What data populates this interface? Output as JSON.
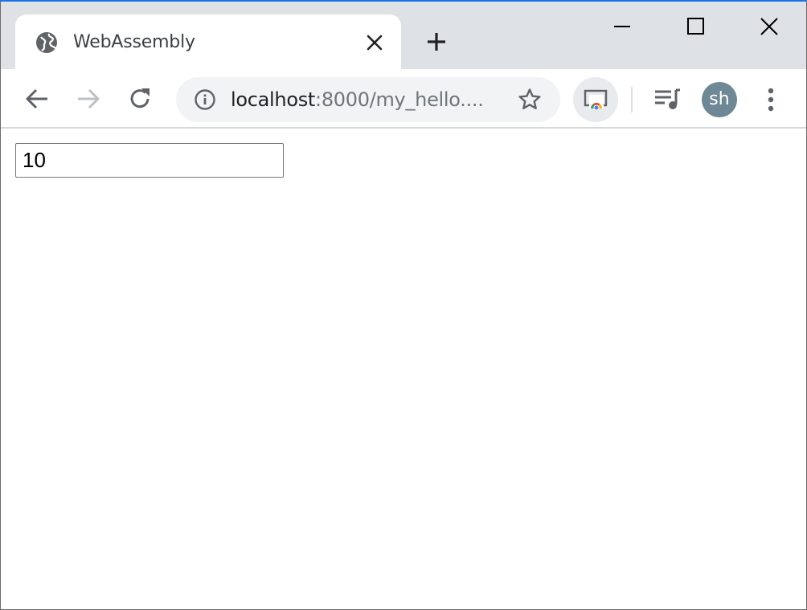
{
  "tab": {
    "title": "WebAssembly",
    "favicon": "globe-icon"
  },
  "window_controls": {
    "minimize": "minimize-icon",
    "maximize": "maximize-icon",
    "close": "close-icon"
  },
  "omnibox": {
    "url_host": "localhost",
    "url_rest": ":8000/my_hello....",
    "info_icon": "info-icon",
    "bookmark_icon": "star-icon"
  },
  "profile": {
    "initials": "sh",
    "color": "#6f8896"
  },
  "page": {
    "input_value": "10"
  },
  "colors": {
    "accent": "#1a73e8",
    "tabstrip_bg": "#dee1e6",
    "omnibox_bg": "#f1f3f4"
  }
}
